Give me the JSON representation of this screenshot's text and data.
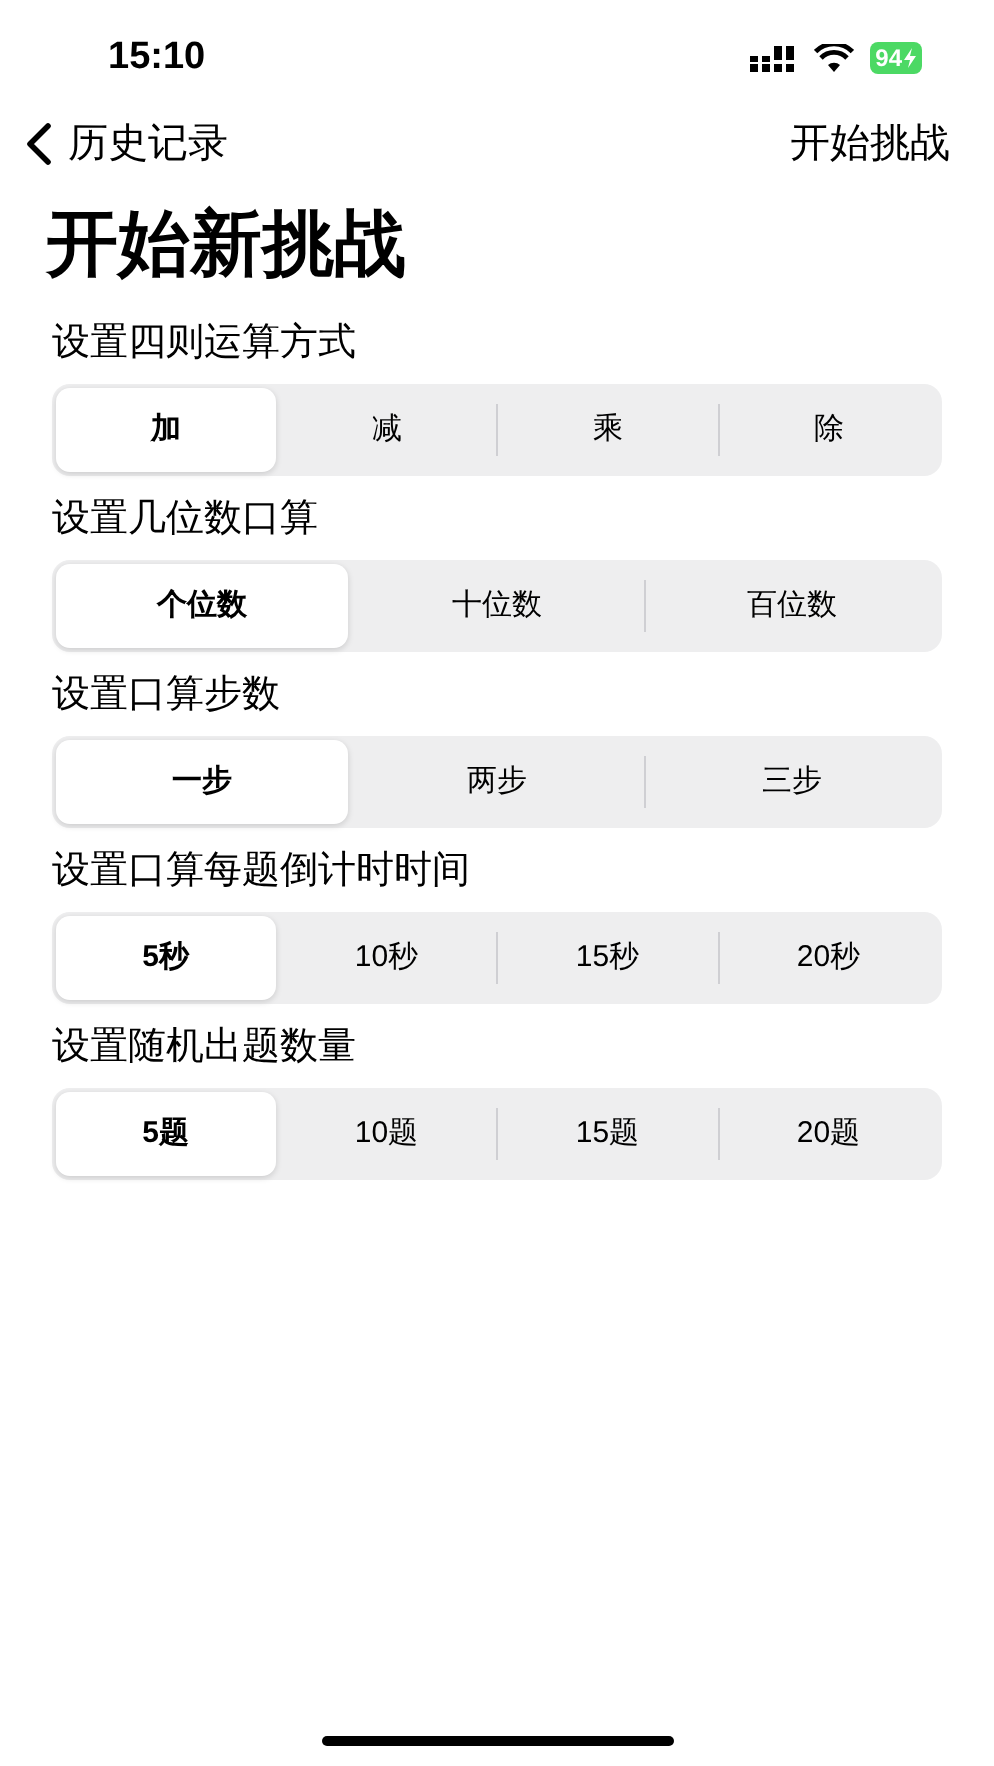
{
  "status_bar": {
    "time": "15:10",
    "battery": "94"
  },
  "nav": {
    "back": "历史记录",
    "action": "开始挑战"
  },
  "title": "开始新挑战",
  "sections": [
    {
      "label": "设置四则运算方式",
      "options": [
        {
          "label": "加",
          "selected": true
        },
        {
          "label": "减",
          "selected": false
        },
        {
          "label": "乘",
          "selected": false
        },
        {
          "label": "除",
          "selected": false
        }
      ]
    },
    {
      "label": "设置几位数口算",
      "options": [
        {
          "label": "个位数",
          "selected": true
        },
        {
          "label": "十位数",
          "selected": false
        },
        {
          "label": "百位数",
          "selected": false
        }
      ]
    },
    {
      "label": "设置口算步数",
      "options": [
        {
          "label": "一步",
          "selected": true
        },
        {
          "label": "两步",
          "selected": false
        },
        {
          "label": "三步",
          "selected": false
        }
      ]
    },
    {
      "label": "设置口算每题倒计时时间",
      "options": [
        {
          "label": "5秒",
          "selected": true
        },
        {
          "label": "10秒",
          "selected": false
        },
        {
          "label": "15秒",
          "selected": false
        },
        {
          "label": "20秒",
          "selected": false
        }
      ]
    },
    {
      "label": "设置随机出题数量",
      "options": [
        {
          "label": "5题",
          "selected": true
        },
        {
          "label": "10题",
          "selected": false
        },
        {
          "label": "15题",
          "selected": false
        },
        {
          "label": "20题",
          "selected": false
        }
      ]
    }
  ]
}
